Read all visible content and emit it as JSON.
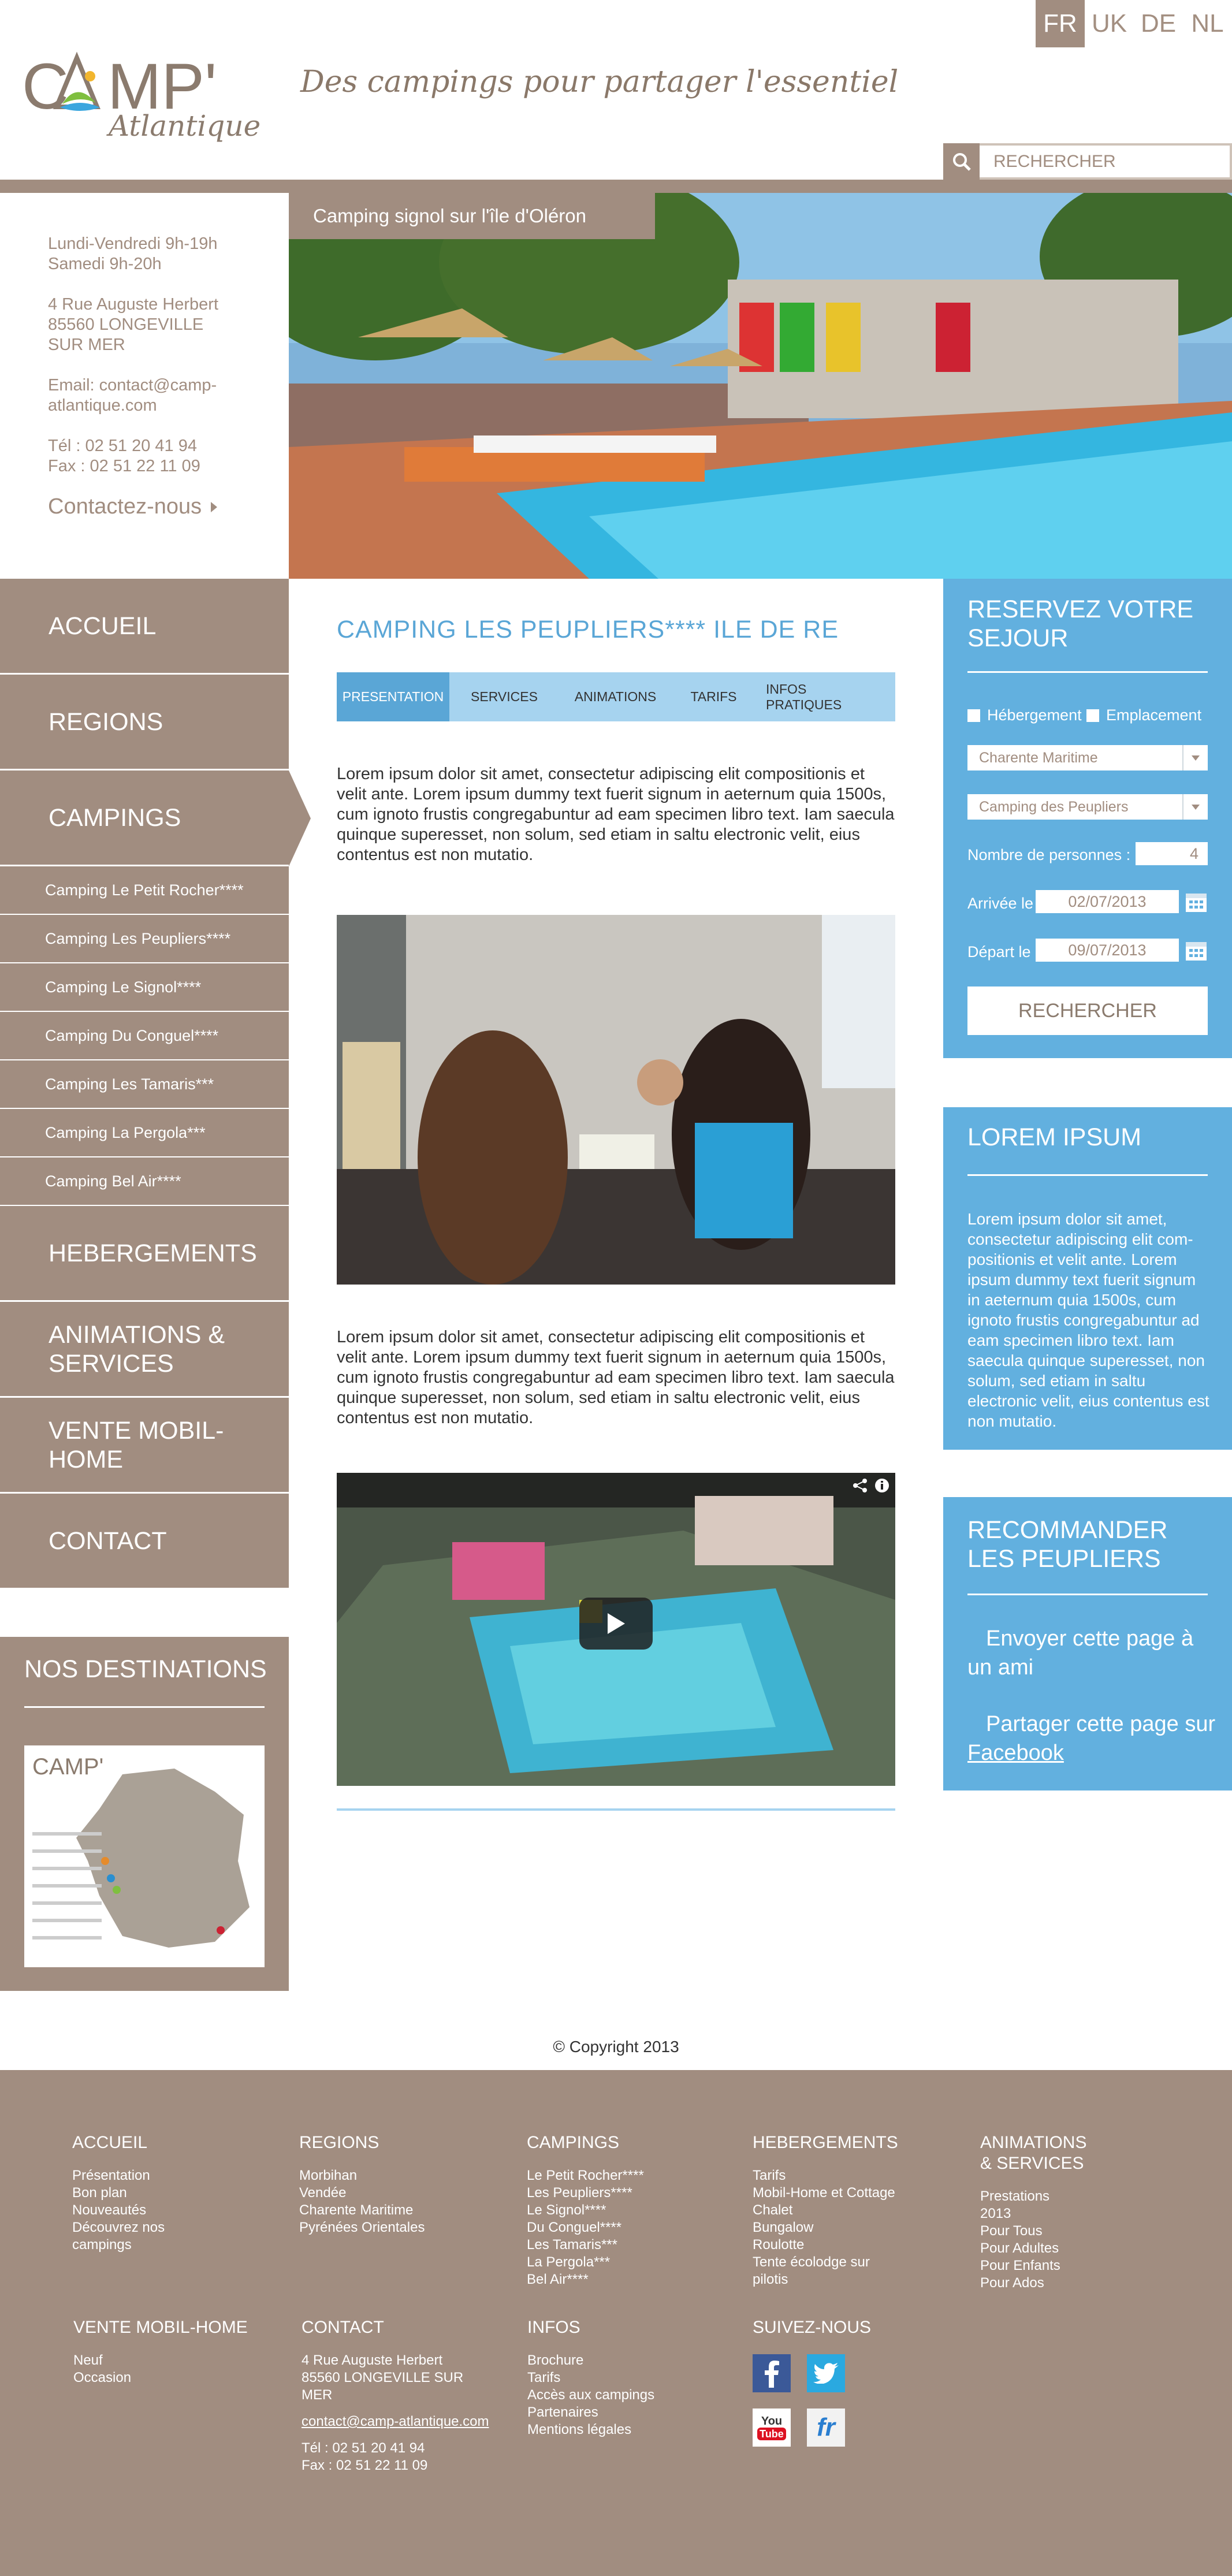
{
  "header": {
    "languages": [
      {
        "code": "FR",
        "active": true
      },
      {
        "code": "UK",
        "active": false
      },
      {
        "code": "DE",
        "active": false
      },
      {
        "code": "NL",
        "active": false
      }
    ],
    "logo_text": "CAMP'",
    "logo_sub": "Atlantique",
    "tagline": "Des campings pour partager l'essentiel",
    "search_placeholder": "RECHERCHER"
  },
  "info": {
    "hours_1": "Lundi-Vendredi 9h-19h",
    "hours_2": "Samedi 9h-20h",
    "address_1": "4 Rue Auguste Herbert",
    "address_2": "85560 LONGEVILLE",
    "address_3": "SUR MER",
    "email": "Email: contact@camp-atlantique.com",
    "tel": "Tél : 02 51 20 41 94",
    "fax": "Fax : 02 51 22 11 09",
    "contact_link": "Contactez-nous"
  },
  "hero": {
    "caption": "Camping signol sur l'île d'Oléron"
  },
  "nav": {
    "accueil": "ACCUEIL",
    "regions": "REGIONS",
    "campings": "CAMPINGS",
    "sub": [
      "Camping Le Petit Rocher****",
      "Camping Les Peupliers****",
      "Camping Le Signol****",
      "Camping Du Conguel****",
      "Camping Les Tamaris***",
      "Camping La Pergola***",
      "Camping Bel Air****"
    ],
    "hebergements": "HEBERGEMENTS",
    "animations": "ANIMATIONS & SERVICES",
    "vente": "VENTE MOBIL-HOME",
    "contact": "CONTACT"
  },
  "destinations": {
    "title": "NOS DESTINATIONS"
  },
  "main": {
    "title": "CAMPING LES PEUPLIERS****  ILE DE RE",
    "tabs": [
      "PRESENTATION",
      "SERVICES",
      "ANIMATIONS",
      "TARIFS",
      "INFOS PRATIQUES"
    ],
    "paragraph_1": "Lorem ipsum dolor sit amet, consectetur adipiscing elit compositionis et velit ante. Lorem ipsum dummy text fuerit signum in aeternum quia 1500s, cum ignoto frustis congregabuntur ad eam specimen libro text. Iam saecula quinque superesset, non solum, sed etiam in saltu electronic velit, eius contentus est non mutatio.",
    "paragraph_2": "Lorem ipsum dolor sit amet, consectetur adipiscing elit compositionis et velit ante. Lorem ipsum dummy text fuerit signum in aeternum quia 1500s, cum ignoto frustis congregabuntur ad eam specimen libro text. Iam saecula quinque superesset, non solum, sed etiam in saltu electronic velit, eius contentus est non mutatio."
  },
  "booking": {
    "title": "RESERVEZ VOTRE SEJOUR",
    "check_1": "Hébergement",
    "check_2": "Emplacement",
    "select_region": "Charente Maritime",
    "select_camping": "Camping des Peupliers",
    "persons_label": "Nombre de personnes :",
    "persons_value": "4",
    "arrival_label": "Arrivée le :",
    "arrival_value": "02/07/2013",
    "departure_label": "Départ le :",
    "departure_value": "09/07/2013",
    "button": "RECHERCHER"
  },
  "lorem_box": {
    "title": "LOREM IPSUM",
    "text": "Lorem ipsum dolor sit amet, consectetur adipiscing elit com-positionis et velit ante. Lorem ipsum dummy text fuerit signum in aeternum quia 1500s, cum ignoto frustis congregabuntur ad eam specimen libro text. Iam saecula quinque superesset, non solum, sed etiam in saltu electronic velit, eius contentus est non mutatio."
  },
  "reco": {
    "title": "RECOMMANDER LES PEUPLIERS",
    "send": "Envoyer cette page à un ami",
    "share_prefix": "Partager cette page sur",
    "share_link": "Facebook"
  },
  "copyright": "© Copyright 2013",
  "footer": {
    "col_accueil": {
      "title": "ACCUEIL",
      "items": [
        "Présentation",
        "Bon plan",
        "Nouveautés",
        "Découvrez nos",
        "campings"
      ]
    },
    "col_regions": {
      "title": "REGIONS",
      "items": [
        "Morbihan",
        "Vendée",
        "Charente Maritime",
        "Pyrénées Orientales"
      ]
    },
    "col_campings": {
      "title": "CAMPINGS",
      "items": [
        "Le Petit Rocher****",
        "Les Peupliers****",
        "Le Signol****",
        "Du Conguel****",
        "Les Tamaris***",
        "La Pergola***",
        "Bel Air****"
      ]
    },
    "col_hebergements": {
      "title": "HEBERGEMENTS",
      "items": [
        "Tarifs",
        "Mobil-Home et Cottage",
        "Chalet",
        "Bungalow",
        "Roulotte",
        "Tente écolodge sur",
        "pilotis"
      ]
    },
    "col_animations": {
      "title_1": "ANIMATIONS",
      "title_2": "& SERVICES",
      "items": [
        "Prestations",
        "2013",
        "Pour Tous",
        "Pour Adultes",
        "Pour Enfants",
        "Pour Ados"
      ]
    },
    "col_vente": {
      "title": "VENTE MOBIL-HOME",
      "items": [
        "Neuf",
        "Occasion"
      ]
    },
    "col_contact": {
      "title": "CONTACT",
      "items": [
        "4 Rue Auguste Herbert",
        "85560 LONGEVILLE SUR",
        "MER"
      ],
      "email": "contact@camp-atlantique.com",
      "tel": "Tél : 02 51 20 41 94",
      "fax": "Fax : 02 51 22 11 09"
    },
    "col_infos": {
      "title": "INFOS",
      "items": [
        "Brochure",
        "Tarifs",
        "Accès aux campings",
        "Partenaires",
        "Mentions légales"
      ]
    },
    "col_suivez": {
      "title": "SUIVEZ-NOUS",
      "youtube_1": "You",
      "youtube_2": "Tube",
      "fr": "fr"
    }
  },
  "colors": {
    "brand_taupe": "#a18d80",
    "accent_blue": "#62b0df",
    "light_blue": "#a6d3ef"
  }
}
